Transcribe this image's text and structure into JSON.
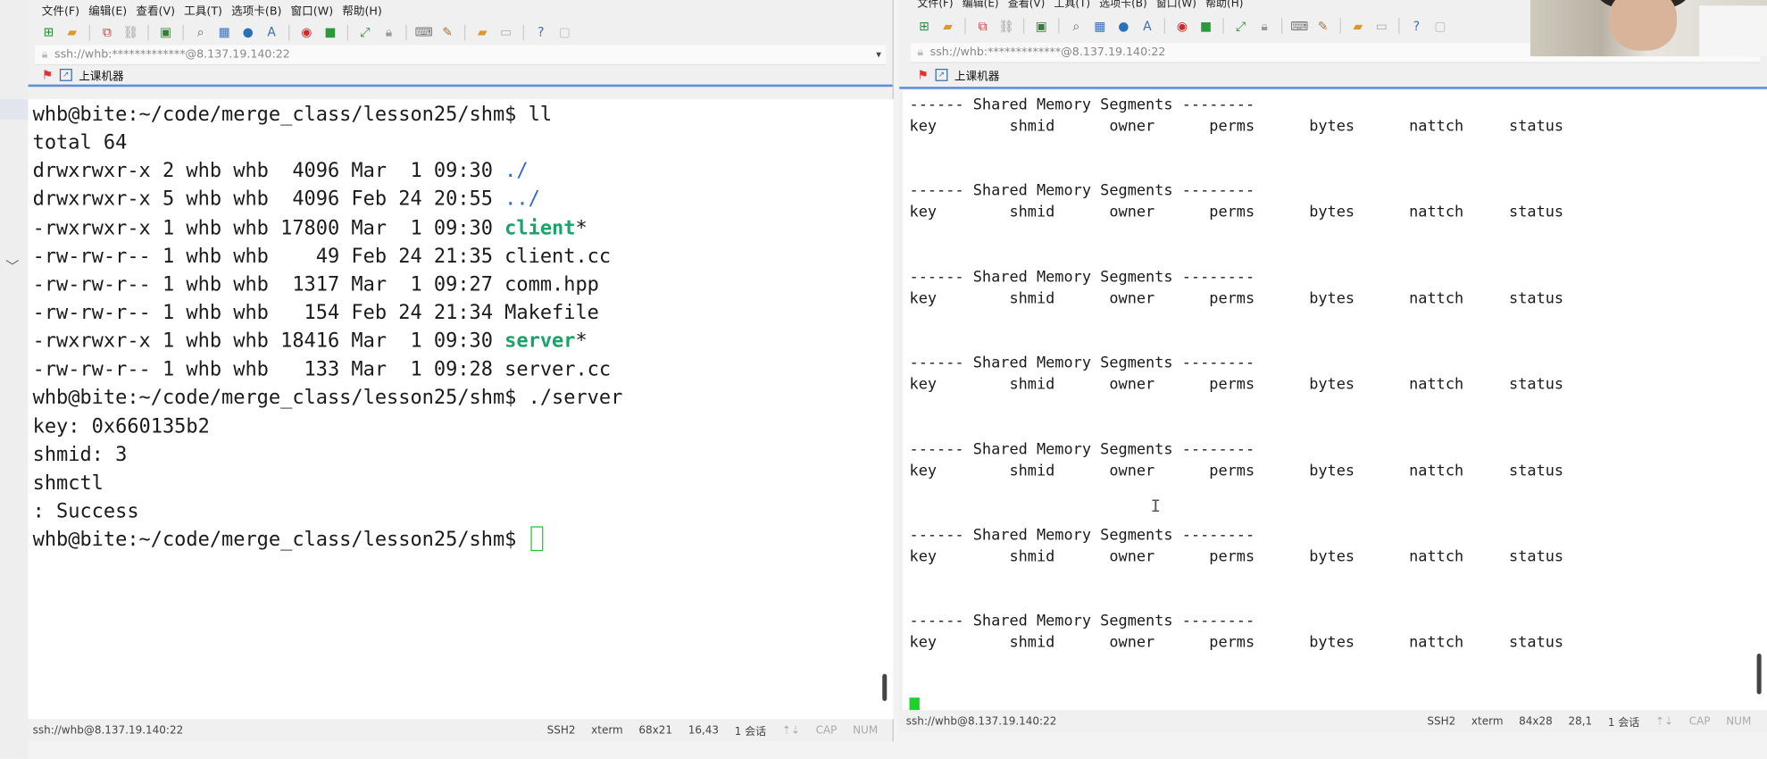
{
  "left": {
    "menu": [
      "文件(F)",
      "编辑(E)",
      "查看(V)",
      "工具(T)",
      "选项卡(B)",
      "窗口(W)",
      "帮助(H)"
    ],
    "address": "ssh://whb:*************@8.137.19.140:22",
    "tab_label": "上课机器",
    "prompt": "whb@bite:~/code/merge_class/lesson25/shm$",
    "cmd1": " ll",
    "total": "total 64",
    "listing": [
      {
        "meta": "drwxrwxr-x 2 whb whb  4096 Mar  1 09:30 ",
        "name": "./",
        "suffix": "",
        "style": "blue"
      },
      {
        "meta": "drwxrwxr-x 5 whb whb  4096 Feb 24 20:55 ",
        "name": "../",
        "suffix": "",
        "style": "blue"
      },
      {
        "meta": "-rwxrwxr-x 1 whb whb 17800 Mar  1 09:30 ",
        "name": "client",
        "suffix": "*",
        "style": "green"
      },
      {
        "meta": "-rw-rw-r-- 1 whb whb    49 Feb 24 21:35 ",
        "name": "client.cc",
        "suffix": "",
        "style": "plain"
      },
      {
        "meta": "-rw-rw-r-- 1 whb whb  1317 Mar  1 09:27 ",
        "name": "comm.hpp",
        "suffix": "",
        "style": "plain"
      },
      {
        "meta": "-rw-rw-r-- 1 whb whb   154 Feb 24 21:34 ",
        "name": "Makefile",
        "suffix": "",
        "style": "plain"
      },
      {
        "meta": "-rwxrwxr-x 1 whb whb 18416 Mar  1 09:30 ",
        "name": "server",
        "suffix": "*",
        "style": "green"
      },
      {
        "meta": "-rw-rw-r-- 1 whb whb   133 Mar  1 09:28 ",
        "name": "server.cc",
        "suffix": "",
        "style": "plain"
      }
    ],
    "cmd2": " ./server",
    "output": [
      "key: 0x660135b2",
      "shmid: 3",
      "shmctl",
      ": Success"
    ],
    "status": {
      "conn": "ssh://whb@8.137.19.140:22",
      "proto": "SSH2",
      "term": "xterm",
      "size": "68x21",
      "pos": "16,43",
      "sessions": "1 会话",
      "cap": "CAP",
      "num": "NUM"
    }
  },
  "right": {
    "menu": [
      "文件(F)",
      "编辑(E)",
      "查看(V)",
      "工具(T)",
      "选项卡(B)",
      "窗口(W)",
      "帮助(H)"
    ],
    "address": "ssh://whb:*************@8.137.19.140:22",
    "tab_label": "上课机器",
    "block_header": "------ Shared Memory Segments --------",
    "block_columns": "key        shmid      owner      perms      bytes      nattch     status",
    "block_count": 7,
    "status": {
      "conn": "ssh://whb@8.137.19.140:22",
      "proto": "SSH2",
      "term": "xterm",
      "size": "84x28",
      "pos": "28,1",
      "sessions": "1 会话",
      "cap": "CAP",
      "num": "NUM"
    }
  }
}
